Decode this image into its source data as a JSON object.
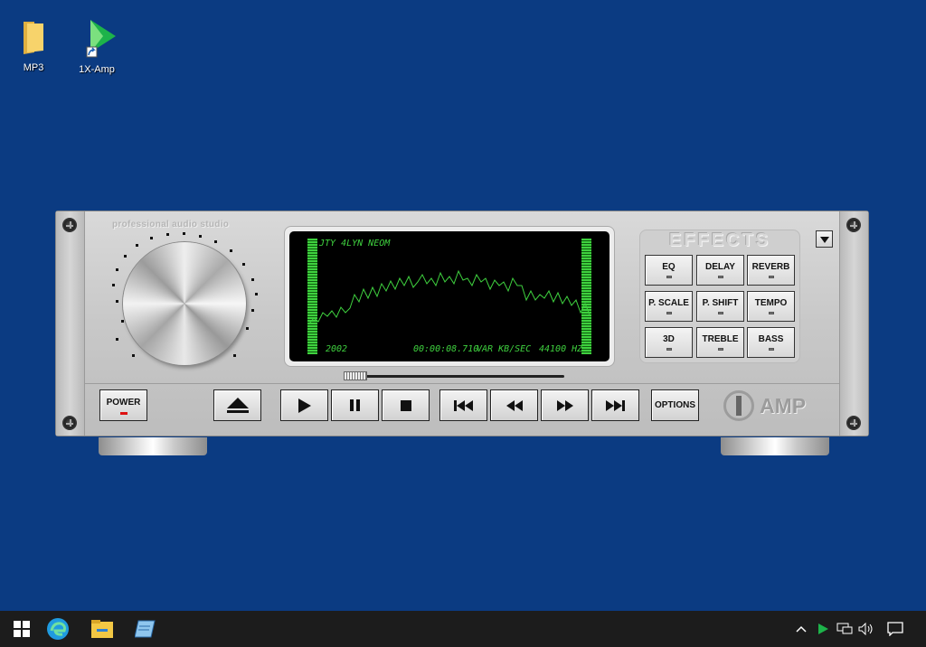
{
  "desktop": {
    "icons": [
      {
        "label": "MP3",
        "icon": "folder-icon"
      },
      {
        "label": "1X-Amp",
        "icon": "amp-shortcut-icon"
      }
    ]
  },
  "player": {
    "brand_text": "professional audio studio",
    "display": {
      "track_title": "JTY 4LYN NEOM",
      "year": "2002",
      "time": "00:00:08.710",
      "bitrate": "VAR KB/SEC",
      "sample_rate": "44100 HZ",
      "color": "#3fd13f"
    },
    "effects": {
      "title": "EFFECTS",
      "buttons": [
        "EQ",
        "DELAY",
        "REVERB",
        "P. SCALE",
        "P. SHIFT",
        "TEMPO",
        "3D",
        "TREBLE",
        "BASS"
      ]
    },
    "controls": {
      "power": "POWER",
      "options": "OPTIONS"
    },
    "logo_text": "AMP"
  },
  "taskbar": {
    "items": [
      "start-icon",
      "edge-icon",
      "file-explorer-icon",
      "notepad-icon"
    ],
    "tray": [
      "chevron-up-icon",
      "amp-tray-icon",
      "network-icon",
      "volume-icon",
      "notification-icon"
    ]
  }
}
